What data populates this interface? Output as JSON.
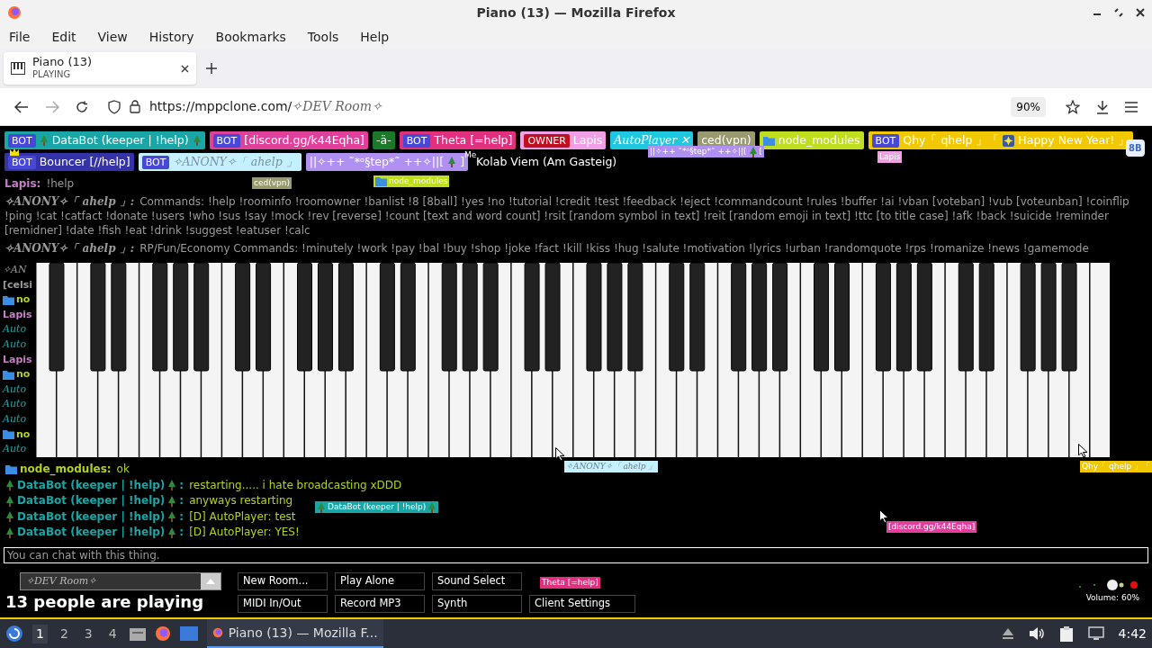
{
  "window": {
    "title": "Piano (13) — Mozilla Firefox"
  },
  "menu": [
    "File",
    "Edit",
    "View",
    "History",
    "Bookmarks",
    "Tools",
    "Help"
  ],
  "tabs": [
    {
      "title": "Piano (13)",
      "subtitle": "PLAYING",
      "selected": true
    }
  ],
  "address_bar": {
    "url": "https://mppclone.com/",
    "room": "✧DEV Room✧",
    "zoom": "90%"
  },
  "corner_badge": "8B",
  "user_rows": [
    [
      {
        "badge": "BOT",
        "color": "#1aa6a6",
        "parts": [
          {
            "kind": "tree"
          },
          {
            "kind": "text",
            "text": "DataBot (keeper | !help)"
          },
          {
            "kind": "tree"
          }
        ]
      },
      {
        "badge": "BOT",
        "color": "#e0409a",
        "parts": [
          {
            "kind": "text",
            "text": "[discord.gg/k44Eqha]"
          }
        ]
      },
      {
        "color": "#1a7a2a",
        "parts": [
          {
            "kind": "text",
            "text": "-ä-"
          }
        ]
      },
      {
        "badge": "BOT",
        "color": "#e0307e",
        "parts": [
          {
            "kind": "text",
            "text": "Theta [=help]"
          }
        ]
      },
      {
        "badge": "OWNER",
        "color": "#f2a0e6",
        "parts": [
          {
            "kind": "text",
            "text": "Lapis"
          }
        ]
      },
      {
        "color": "#1ec8e0",
        "parts": [
          {
            "kind": "script",
            "text": "AutoPlayer ✕"
          }
        ]
      },
      {
        "color": "#9a9a70",
        "parts": [
          {
            "kind": "text",
            "text": "ced(vpn)"
          }
        ]
      },
      {
        "color": "#bede1e",
        "parts": [
          {
            "kind": "folder"
          },
          {
            "kind": "text",
            "text": "node_modules"
          }
        ]
      },
      {
        "badge": "BOT",
        "color": "#f2c800",
        "parts": [
          {
            "kind": "text",
            "text": "Qhy「 qhelp 」「"
          },
          {
            "kind": "star"
          },
          {
            "kind": "text",
            "text": "Happy New Year! 」"
          }
        ]
      }
    ],
    [
      {
        "badge": "BOT",
        "color": "#3434a8",
        "parts": [
          {
            "kind": "text",
            "text": "Bouncer [//help]"
          }
        ]
      },
      {
        "badge": "BOT",
        "color": "#c4f0ff",
        "parts": [
          {
            "kind": "script",
            "text": "✧ANONY✧「 ahelp 」"
          }
        ]
      },
      {
        "color": "#b090f0",
        "parts": [
          {
            "kind": "text",
            "text": "||✧++ ˜*ᵒ§tep*˜ ++✧||["
          },
          {
            "kind": "tree"
          },
          {
            "kind": "text",
            "text": "]"
          }
        ]
      },
      {
        "parts": [
          {
            "kind": "text",
            "text": "Kolab Viem (Am Gasteig)"
          }
        ]
      }
    ]
  ],
  "chat_top": [
    {
      "name": [
        {
          "kind": "text",
          "text": "Lapis:"
        }
      ],
      "color": "#c77dc7",
      "text": "!help"
    },
    {
      "name": [
        {
          "kind": "script",
          "text": "✧ANONY✧「 ahelp 」:"
        }
      ],
      "color": "#9a9a9a",
      "text": "Commands: !help !roominfo !roomowner !banlist !8 [8ball] !yes !no !tutorial !credit !test !feedback !eject !commandcount !rules !buffer !ai !vban [voteban] !vub [voteunban] !coinflip !ping !cat !catfact !donate !users !who !sus !say !mock !rev [reverse] !count [text and word count] !rsit [random symbol in text] !reit [random emoji in text] !ttc [to title case] !afk !back !suicide !reminder [remidner] !date !fish !eat !drink !suggest !eatuser !calc"
    },
    {
      "name": [
        {
          "kind": "script",
          "text": "✧ANONY✧「 ahelp 」:"
        }
      ],
      "color": "#9a9a9a",
      "text": "RP/Fun/Economy Commands: !minutely !work !pay !bal !buy !shop !joke !fact !kill !kiss !hug !salute !motivation !lyrics !urban !randomquote !rps !romanize !news !gamemode"
    }
  ],
  "chat_fragments": [
    {
      "text": "✧AN",
      "color": "#9a9a9a",
      "kind": "script"
    },
    {
      "text": "[celsi",
      "color": "#9a9a9a",
      "kind": "text"
    },
    {
      "text": "no",
      "color": "#b5d020",
      "kind": "folder"
    },
    {
      "text": "Lapis",
      "color": "#c77dc7",
      "kind": "text"
    },
    {
      "text": "Auto",
      "color": "#1aa6a6",
      "kind": "script"
    },
    {
      "text": "Auto",
      "color": "#1aa6a6",
      "kind": "script"
    },
    {
      "text": "Lapis",
      "color": "#c77dc7",
      "kind": "text"
    },
    {
      "text": "no",
      "color": "#b5d020",
      "kind": "folder"
    },
    {
      "text": "Auto",
      "color": "#1aa6a6",
      "kind": "script"
    },
    {
      "text": "Auto",
      "color": "#1aa6a6",
      "kind": "script"
    },
    {
      "text": "Auto",
      "color": "#1aa6a6",
      "kind": "script"
    },
    {
      "text": "no",
      "color": "#b5d020",
      "kind": "folder"
    },
    {
      "text": "Auto",
      "color": "#1aa6a6",
      "kind": "script"
    }
  ],
  "chat_bottom": [
    {
      "name": [
        {
          "kind": "folder"
        },
        {
          "kind": "text",
          "text": "node_modules:"
        }
      ],
      "color": "#b5d020",
      "text": "ok"
    },
    {
      "name": [
        {
          "kind": "tree"
        },
        {
          "kind": "text",
          "text": "DataBot (keeper | !help)"
        },
        {
          "kind": "tree"
        },
        {
          "kind": "text",
          "text": ":"
        }
      ],
      "color": "#1aa6a6",
      "text": "restarting..... i hate broadcasting xDDD"
    },
    {
      "name": [
        {
          "kind": "tree"
        },
        {
          "kind": "text",
          "text": "DataBot (keeper | !help)"
        },
        {
          "kind": "tree"
        },
        {
          "kind": "text",
          "text": ":"
        }
      ],
      "color": "#1aa6a6",
      "text": "anyways restarting"
    },
    {
      "name": [
        {
          "kind": "tree"
        },
        {
          "kind": "text",
          "text": "DataBot (keeper | !help)"
        },
        {
          "kind": "tree"
        },
        {
          "kind": "text",
          "text": ":"
        }
      ],
      "color": "#1aa6a6",
      "text": "[D] AutoPlayer: test"
    },
    {
      "name": [
        {
          "kind": "tree"
        },
        {
          "kind": "text",
          "text": "DataBot (keeper | !help)"
        },
        {
          "kind": "tree"
        },
        {
          "kind": "text",
          "text": ":"
        }
      ],
      "color": "#1aa6a6",
      "text": "[D] AutoPlayer: YES!"
    }
  ],
  "cursor_labels": [
    {
      "color": "#9a9a70",
      "parts": [
        {
          "kind": "text",
          "text": "ced(vpn)"
        }
      ]
    },
    {
      "parts": [
        {
          "kind": "text",
          "text": "Me"
        }
      ]
    },
    {
      "color": "#bede1e",
      "parts": [
        {
          "kind": "folder"
        },
        {
          "kind": "text",
          "text": "node_modules"
        }
      ]
    },
    {
      "color": "#b090f0",
      "parts": [
        {
          "kind": "text",
          "text": "||✧++ ˜*ᵒ§tep*˜ ++✧||["
        },
        {
          "kind": "tree"
        },
        {
          "kind": "text",
          "text": "["
        }
      ]
    },
    {
      "color": "#f2a0e6",
      "parts": [
        {
          "kind": "text",
          "text": "Lapis"
        }
      ]
    },
    {
      "color": "#c4f0ff",
      "parts": [
        {
          "kind": "script",
          "text": "✧ANONY✧「 ahelp 」"
        }
      ]
    },
    {
      "color": "#f2c800",
      "parts": [
        {
          "kind": "text",
          "text": "Qhy「 qhelp 」「"
        }
      ]
    },
    {
      "color": "#1aa6a6",
      "parts": [
        {
          "kind": "tree"
        },
        {
          "kind": "text",
          "text": "DataBot (keeper | !help)"
        },
        {
          "kind": "tree"
        }
      ]
    },
    {
      "color": "#e0409a",
      "parts": [
        {
          "kind": "text",
          "text": "[discord.gg/k44Eqha]"
        }
      ]
    },
    {
      "color": "#e0307e",
      "parts": [
        {
          "kind": "text",
          "text": "Theta [=help]"
        }
      ]
    }
  ],
  "chat_input": {
    "placeholder": "You can chat with this thing."
  },
  "room_select": {
    "value": "✧DEV Room✧"
  },
  "player_count": "13 people are playing",
  "buttons": [
    [
      "New Room...",
      "Play Alone",
      "Sound Select"
    ],
    [
      "MIDI In/Out",
      "Record MP3",
      "Synth",
      "Client Settings"
    ]
  ],
  "volume": {
    "label": "Volume: 60%"
  },
  "taskbar": {
    "workspaces": [
      {
        "label": "1",
        "selected": true
      },
      {
        "label": "2",
        "selected": false
      },
      {
        "label": "3",
        "selected": false
      },
      {
        "label": "4",
        "selected": false
      }
    ],
    "task": "Piano (13) — Mozilla F...",
    "clock": "4:42"
  }
}
